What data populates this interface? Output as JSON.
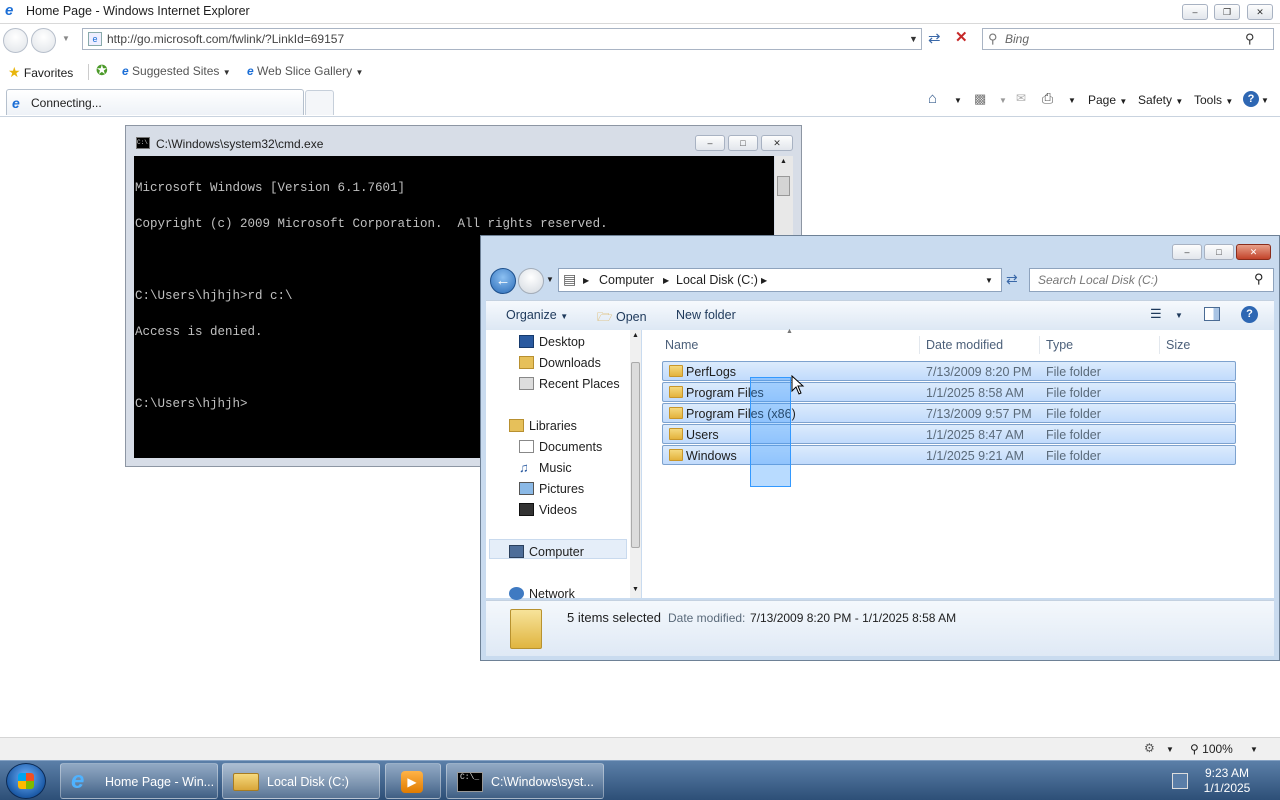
{
  "ie": {
    "title": "Home Page - Windows Internet Explorer",
    "address": "http://go.microsoft.com/fwlink/?LinkId=69157",
    "search_placeholder": "Bing",
    "favorites_label": "Favorites",
    "suggested_sites": "Suggested Sites",
    "web_slice_gallery": "Web Slice Gallery",
    "tab_label": "Connecting...",
    "commands": {
      "page": "Page",
      "safety": "Safety",
      "tools": "Tools"
    },
    "zoom": "100%"
  },
  "cmd": {
    "title": "C:\\Windows\\system32\\cmd.exe",
    "lines": [
      "Microsoft Windows [Version 6.1.7601]",
      "Copyright (c) 2009 Microsoft Corporation.  All rights reserved.",
      "",
      "C:\\Users\\hjhjh>rd c:\\",
      "Access is denied.",
      "",
      "C:\\Users\\hjhjh>"
    ]
  },
  "explorer": {
    "breadcrumb": [
      "Computer",
      "Local Disk (C:)"
    ],
    "search_placeholder": "Search Local Disk (C:)",
    "toolbar": {
      "organize": "Organize",
      "open": "Open",
      "new_folder": "New folder"
    },
    "nav": {
      "favorites": [
        "Desktop",
        "Downloads",
        "Recent Places"
      ],
      "libraries": "Libraries",
      "library_items": [
        "Documents",
        "Music",
        "Pictures",
        "Videos"
      ],
      "computer": "Computer",
      "network": "Network"
    },
    "columns": {
      "name": "Name",
      "date": "Date modified",
      "type": "Type",
      "size": "Size"
    },
    "rows": [
      {
        "name": "PerfLogs",
        "date": "7/13/2009 8:20 PM",
        "type": "File folder"
      },
      {
        "name": "Program Files",
        "date": "1/1/2025 8:58 AM",
        "type": "File folder"
      },
      {
        "name": "Program Files (x86)",
        "date": "7/13/2009 9:57 PM",
        "type": "File folder"
      },
      {
        "name": "Users",
        "date": "1/1/2025 8:47 AM",
        "type": "File folder"
      },
      {
        "name": "Windows",
        "date": "1/1/2025 9:21 AM",
        "type": "File folder"
      }
    ],
    "details": {
      "selected": "5 items selected",
      "date_label": "Date modified:",
      "date_range": "7/13/2009 8:20 PM - 1/1/2025 8:58 AM"
    }
  },
  "taskbar": {
    "ie": "Home Page - Win...",
    "explorer": "Local Disk (C:)",
    "cmd": "C:\\Windows\\syst...",
    "time": "9:23 AM",
    "date": "1/1/2025"
  }
}
